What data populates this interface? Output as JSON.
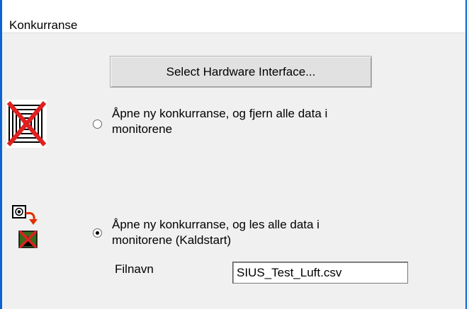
{
  "window": {
    "title": "Konkurranse"
  },
  "hardware_button": {
    "label": "Select Hardware Interface..."
  },
  "options": [
    {
      "line1": "Åpne ny konkurranse, og fjern alle data i",
      "line2": "monitorene",
      "selected": false,
      "icon": "target-crossed-icon"
    },
    {
      "line1": "Åpne ny konkurranse, og les alle data i",
      "line2": "monitorene (Kaldstart)",
      "selected": true,
      "icon": "monitor-transfer-icon"
    }
  ],
  "filename": {
    "label": "Filnavn",
    "value": "SIUS_Test_Luft.csv"
  },
  "colors": {
    "window_border": "#0a64d2",
    "cross": "#e02020",
    "arrow": "#e03000",
    "background": "#f0f0f0"
  }
}
